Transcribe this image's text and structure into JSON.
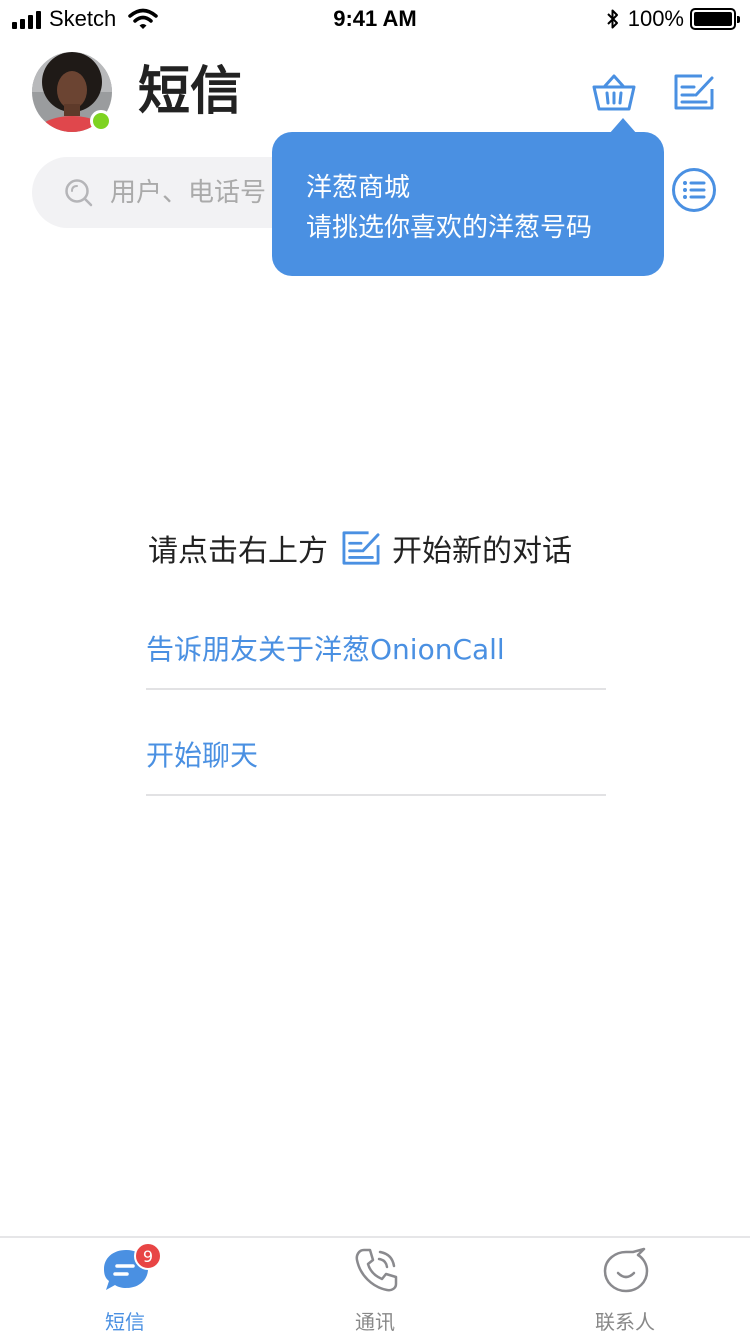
{
  "status_bar": {
    "carrier": "Sketch",
    "time": "9:41 AM",
    "battery": "100%"
  },
  "header": {
    "title": "短信",
    "avatar_status": "online",
    "colors": {
      "accent": "#4a90e2",
      "online": "#7ed321"
    }
  },
  "search": {
    "placeholder": "用户、电话号"
  },
  "tooltip": {
    "line1": "洋葱商城",
    "line2": "请挑选你喜欢的洋葱号码"
  },
  "empty_state": {
    "hint_before": "请点击右上方",
    "hint_after": "开始新的对话",
    "links": [
      {
        "label": "告诉朋友关于洋葱OnionCall"
      },
      {
        "label": "开始聊天"
      }
    ]
  },
  "tabbar": {
    "tabs": [
      {
        "label": "短信",
        "icon": "chat-bubble-icon",
        "active": true,
        "badge": "9"
      },
      {
        "label": "通讯",
        "icon": "phone-icon",
        "active": false
      },
      {
        "label": "联系人",
        "icon": "contacts-icon",
        "active": false
      }
    ]
  }
}
